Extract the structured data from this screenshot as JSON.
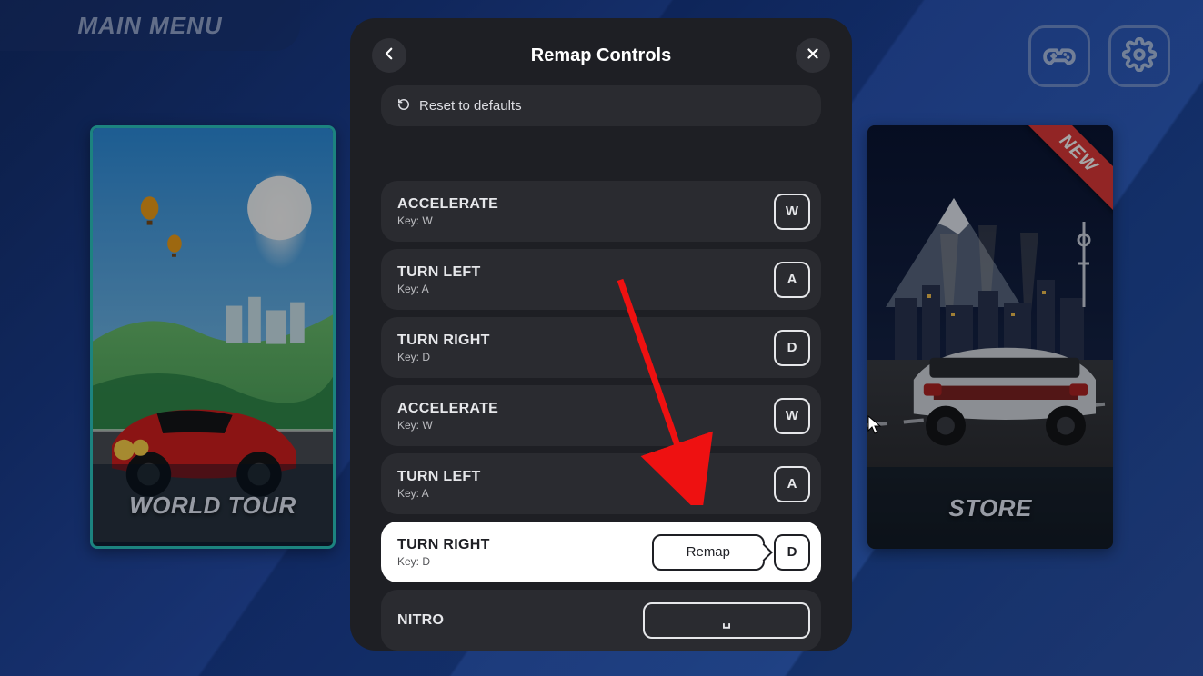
{
  "header": {
    "main_menu": "MAIN MENU"
  },
  "top_icons": {
    "controller": "controller-icon",
    "settings": "settings-icon"
  },
  "cards": {
    "world_tour": "WORLD TOUR",
    "store": "STORE",
    "new_badge": "NEW"
  },
  "modal": {
    "title": "Remap Controls",
    "reset": "Reset to defaults",
    "remap_tip": "Remap",
    "key_prefix": "Key: ",
    "controls": [
      {
        "name": "ACCELERATE",
        "key": "W",
        "active": false
      },
      {
        "name": "TURN LEFT",
        "key": "A",
        "active": false
      },
      {
        "name": "TURN RIGHT",
        "key": "D",
        "active": false
      },
      {
        "name": "ACCELERATE",
        "key": "W",
        "active": false
      },
      {
        "name": "TURN LEFT",
        "key": "A",
        "active": false
      },
      {
        "name": "TURN RIGHT",
        "key": "D",
        "active": true
      },
      {
        "name": "NITRO",
        "key": "␣",
        "active": false,
        "wide": true
      }
    ]
  }
}
